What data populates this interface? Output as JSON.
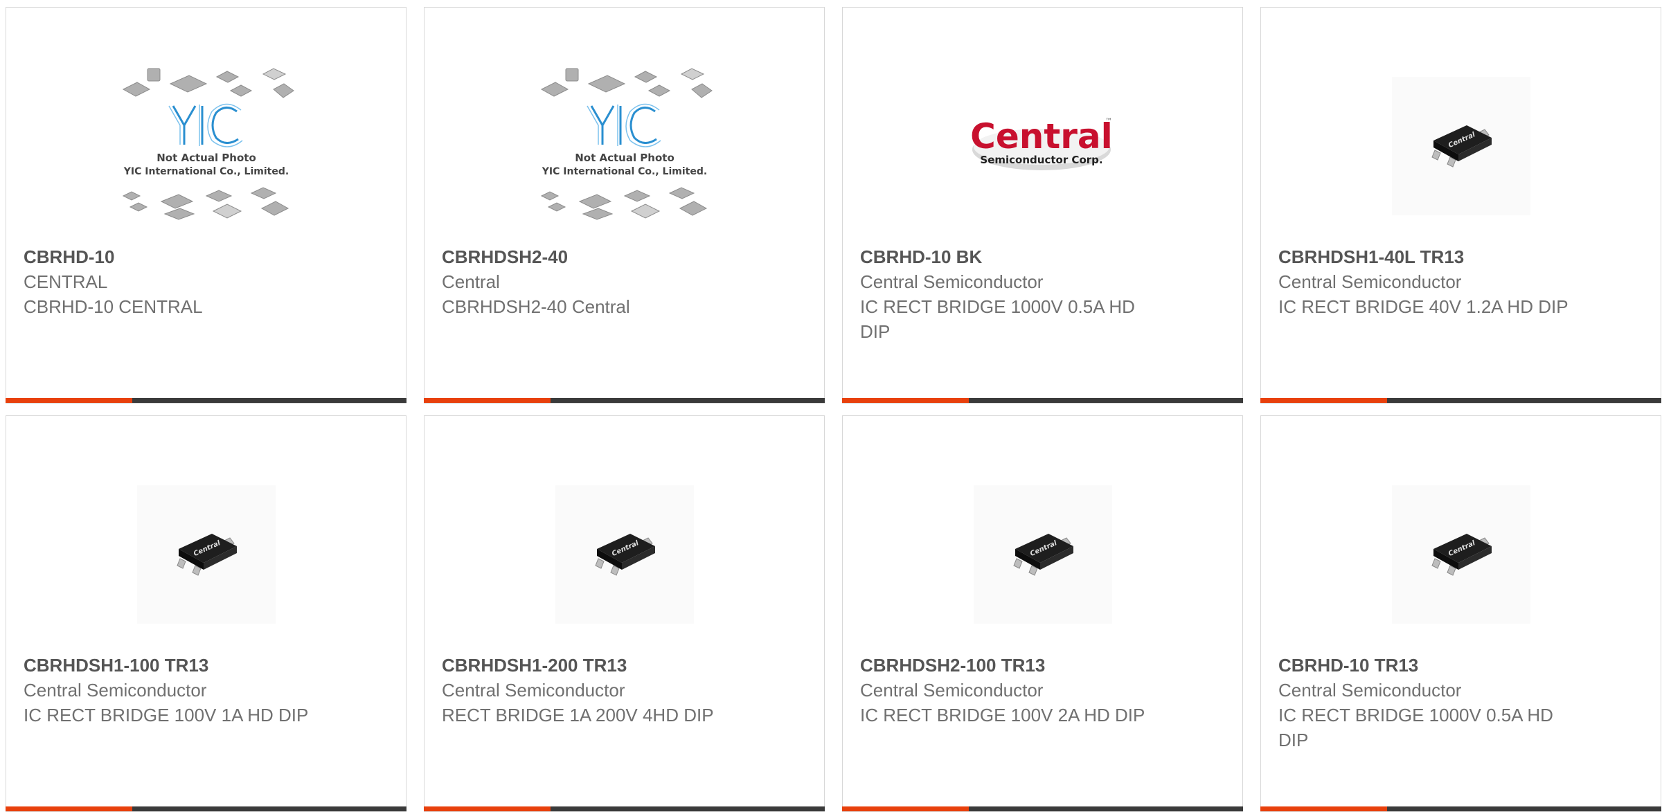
{
  "colors": {
    "accent": "#e8400c",
    "bar": "#3a3a3a",
    "border": "#d8d8d8",
    "text": "#707070"
  },
  "placeholder_image": {
    "line1": "Not Actual Photo",
    "line2": "YIC International Co., Limited.",
    "logo": "YIC"
  },
  "central_logo": {
    "word": "Central",
    "tag": "Semiconductor Corp.",
    "tm": "™"
  },
  "chip_marking": "Central",
  "products": [
    {
      "part_number": "CBRHD-10",
      "manufacturer": "CENTRAL",
      "description": "CBRHD-10 CENTRAL",
      "image": "yic-placeholder"
    },
    {
      "part_number": "CBRHDSH2-40",
      "manufacturer": "Central",
      "description": "CBRHDSH2-40 Central",
      "image": "yic-placeholder"
    },
    {
      "part_number": "CBRHD-10 BK",
      "manufacturer": "Central Semiconductor",
      "description": "IC RECT BRIDGE 1000V 0.5A HD DIP",
      "image": "central-logo"
    },
    {
      "part_number": "CBRHDSH1-40L TR13",
      "manufacturer": "Central Semiconductor",
      "description": "IC RECT BRIDGE 40V 1.2A HD DIP",
      "image": "chip"
    },
    {
      "part_number": "CBRHDSH1-100 TR13",
      "manufacturer": "Central Semiconductor",
      "description": "IC RECT BRIDGE 100V 1A HD DIP",
      "image": "chip"
    },
    {
      "part_number": "CBRHDSH1-200 TR13",
      "manufacturer": "Central Semiconductor",
      "description": "RECT BRIDGE 1A 200V 4HD DIP",
      "image": "chip"
    },
    {
      "part_number": "CBRHDSH2-100 TR13",
      "manufacturer": "Central Semiconductor",
      "description": "IC RECT BRIDGE 100V 2A HD DIP",
      "image": "chip"
    },
    {
      "part_number": "CBRHD-10 TR13",
      "manufacturer": "Central Semiconductor",
      "description": "IC RECT BRIDGE 1000V 0.5A HD DIP",
      "image": "chip"
    }
  ]
}
